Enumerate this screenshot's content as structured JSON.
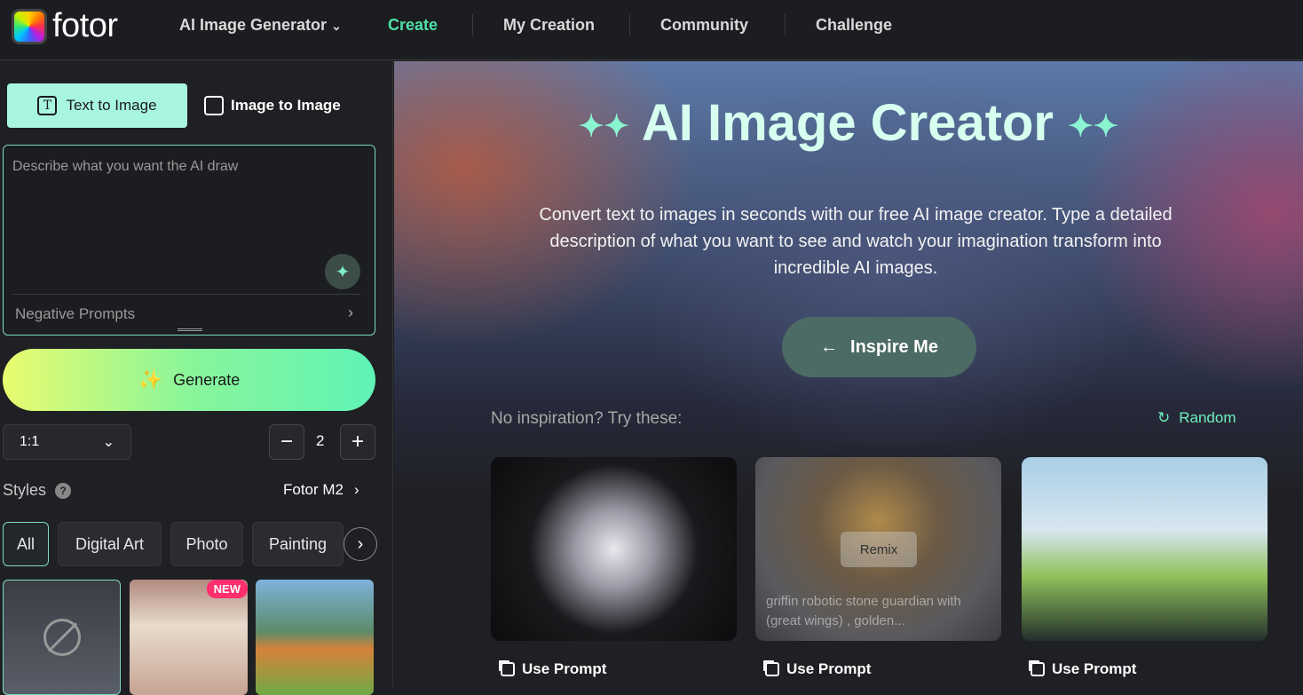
{
  "header": {
    "logo": "fotor",
    "nav": [
      {
        "label": "AI Image Generator"
      },
      {
        "label": "Create",
        "active": true
      },
      {
        "label": "My Creation"
      },
      {
        "label": "Community"
      },
      {
        "label": "Challenge"
      }
    ],
    "accent": "#4fe0a8"
  },
  "sidebar": {
    "tabs": [
      {
        "label": "Text to Image",
        "active": true
      },
      {
        "label": "Image to Image"
      }
    ],
    "prompt_placeholder": "Describe what you want the AI draw",
    "negative_prompts": "Negative Prompts",
    "generate": "Generate",
    "ratio": "1:1",
    "count": "2",
    "styles_label": "Styles",
    "model": "Fotor M2",
    "style_chips": [
      {
        "label": "All",
        "active": true
      },
      {
        "label": "Digital Art"
      },
      {
        "label": "Photo"
      },
      {
        "label": "Painting"
      }
    ],
    "new_badge": "NEW"
  },
  "hero": {
    "title": "AI Image Creator",
    "subtitle": "Convert text to images in seconds with our free AI image creator. Type a detailed description of what you want to see and watch your imagination transform into incredible AI images.",
    "inspire": "Inspire Me"
  },
  "inspiration": {
    "label": "No inspiration? Try these:",
    "random": "Random",
    "remix": "Remix",
    "cards": [
      {
        "use": "Use Prompt"
      },
      {
        "use": "Use Prompt",
        "caption": "griffin robotic stone guardian with (great wings) , golden..."
      },
      {
        "use": "Use Prompt"
      }
    ]
  }
}
